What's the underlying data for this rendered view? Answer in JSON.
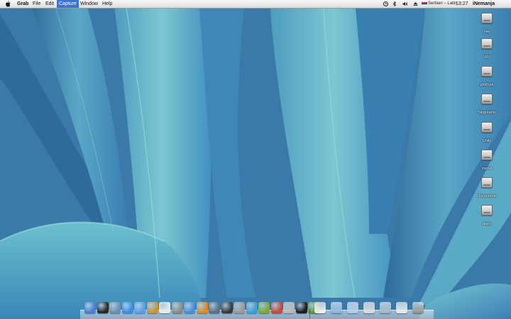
{
  "menubar": {
    "app_name": "Grab",
    "menus": [
      "File",
      "Edit",
      "Capture",
      "Window",
      "Help"
    ],
    "active_menu": "Capture",
    "input_source": "Serbian – Latin",
    "clock": "13:27",
    "user": "iNemanja"
  },
  "desktop_icons": [
    "nse",
    "XP",
    "phWork",
    "Singularity",
    "Unity",
    "nwork",
    "Documents",
    "apps"
  ],
  "dock": {
    "apps": [
      {
        "icon": "finder-icon",
        "color": "#4a7fd0"
      },
      {
        "icon": "dashboard-icon",
        "color": "#2b2b2b"
      },
      {
        "icon": "preview-icon",
        "color": "#6f8fb0"
      },
      {
        "icon": "safari-icon",
        "color": "#3a8ee0"
      },
      {
        "icon": "ichat-icon",
        "color": "#5aa0e8"
      },
      {
        "icon": "address-book-icon",
        "color": "#c8963c"
      },
      {
        "icon": "ical-icon",
        "color": "#e8e8e8"
      },
      {
        "icon": "photo-booth-icon",
        "color": "#8a8a8a"
      },
      {
        "icon": "itunes-icon",
        "color": "#4a90d8"
      },
      {
        "icon": "iphoto-icon",
        "color": "#d98a2a"
      },
      {
        "icon": "spaces-icon",
        "color": "#5b6f85"
      },
      {
        "icon": "time-machine-icon",
        "color": "#3a3a3a"
      },
      {
        "icon": "system-preferences-icon",
        "color": "#9a9a9a"
      },
      {
        "icon": "network-icon",
        "color": "#39a0d8"
      },
      {
        "icon": "android-icon",
        "color": "#7aa83a"
      },
      {
        "icon": "joystick-icon",
        "color": "#c94a3a"
      },
      {
        "icon": "grab-icon",
        "color": "#b8b8b8"
      },
      {
        "icon": "terminal-icon",
        "color": "#1e1e1e"
      },
      {
        "icon": "activity-icon",
        "color": "#5a9a3a"
      }
    ],
    "stacks": [
      {
        "icon": "document-stack-icon",
        "color": "#f0f0f0"
      },
      {
        "icon": "folder-stack-icon",
        "color": "#7fb0e0"
      },
      {
        "icon": "downloads-stack-icon",
        "color": "#a8c8e8"
      },
      {
        "icon": "window-stack-icon",
        "color": "#d8d8d8"
      },
      {
        "icon": "screenshots-stack-icon",
        "color": "#9ab0c8"
      },
      {
        "icon": "file-stack-icon",
        "color": "#e8e8e8"
      },
      {
        "icon": "trash-icon",
        "color": "#8c8c8c"
      }
    ]
  }
}
